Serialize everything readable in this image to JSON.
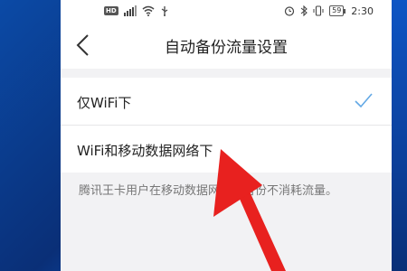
{
  "status_bar": {
    "hd": "HD",
    "battery": "59",
    "time": "2:30"
  },
  "header": {
    "title": "自动备份流量设置"
  },
  "options": [
    {
      "label": "仅WiFi下",
      "selected": true
    },
    {
      "label": "WiFi和移动数据网络下",
      "selected": false
    }
  ],
  "note": "腾讯王卡用户在移动数据网络下备份不消耗流量。",
  "colors": {
    "accent": "#62a8e5",
    "arrow": "#e8211f"
  }
}
